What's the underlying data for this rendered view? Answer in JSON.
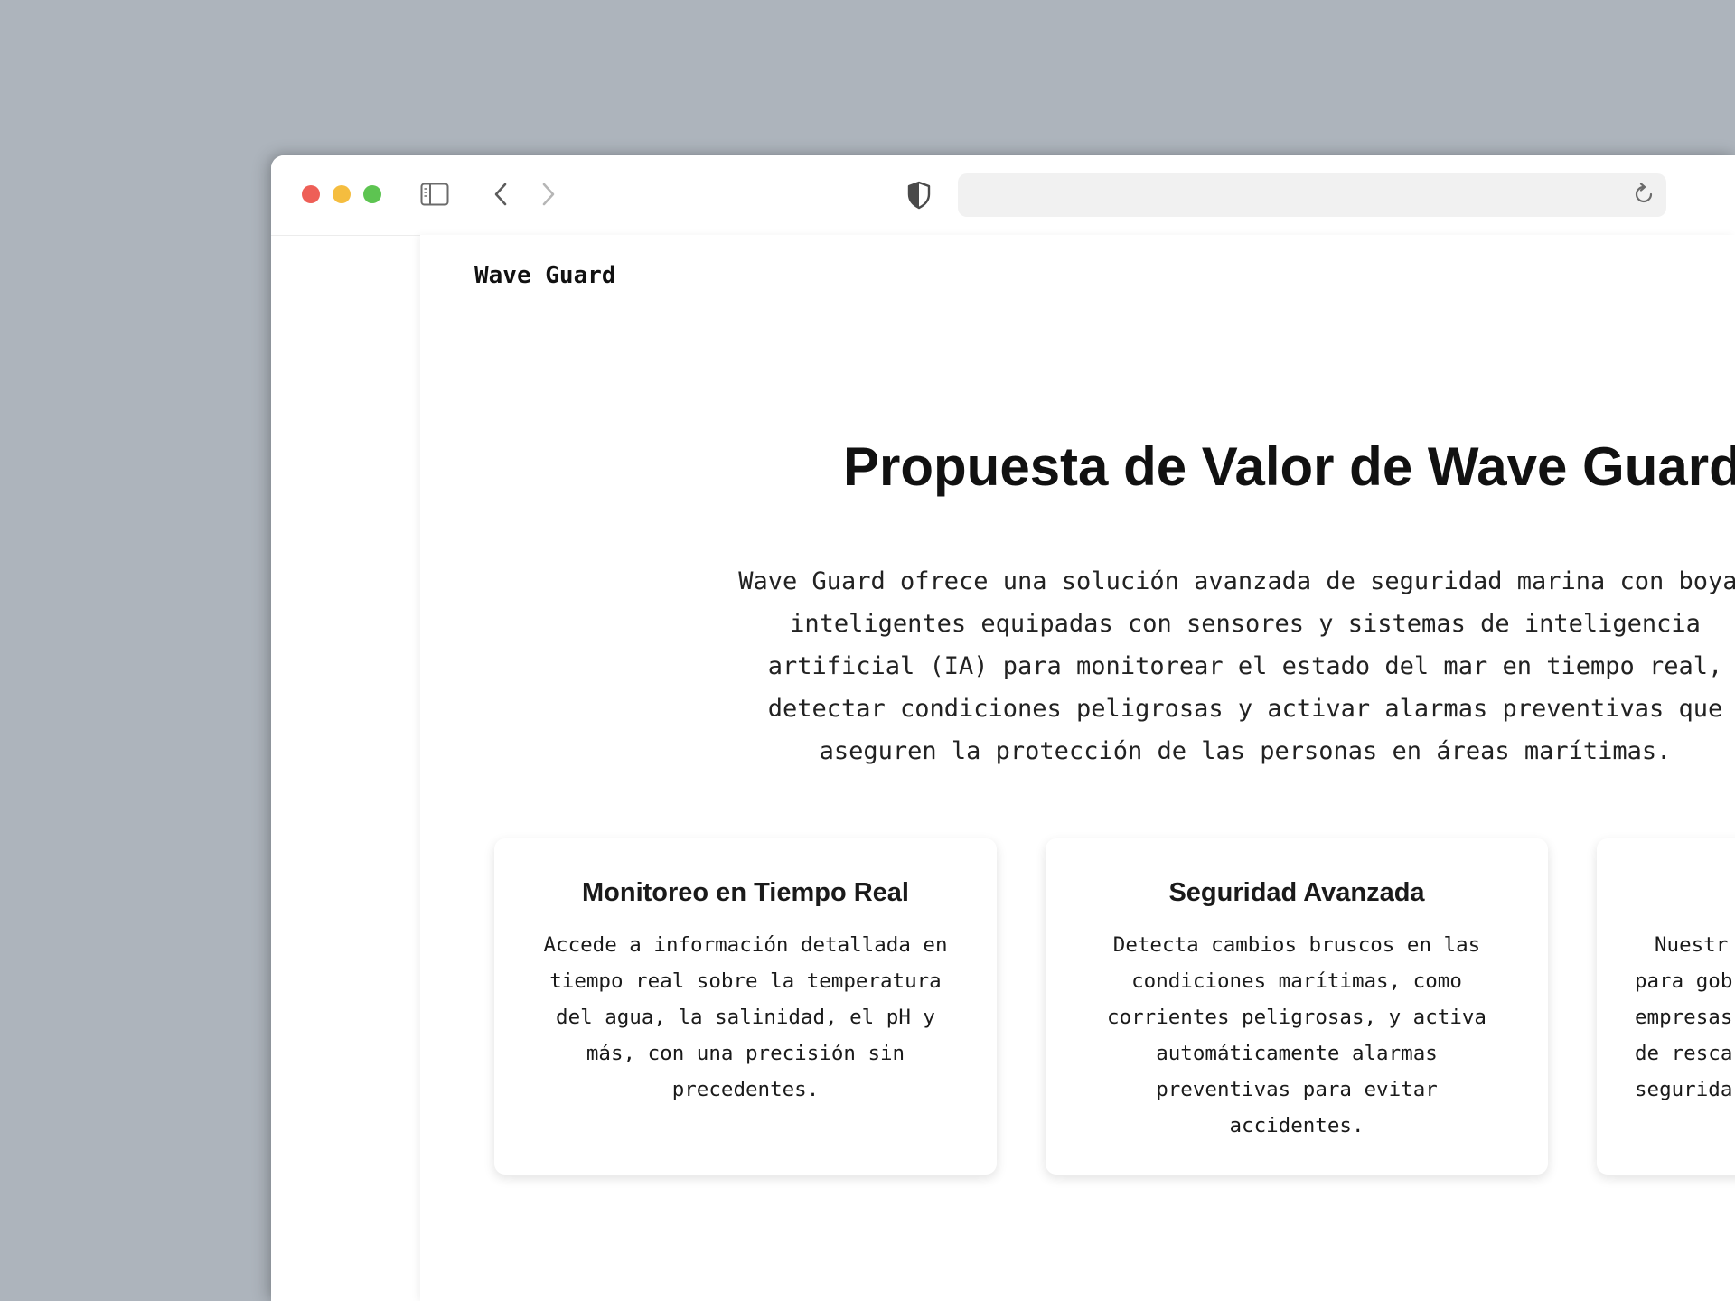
{
  "site": {
    "brand": "Wave Guard"
  },
  "browser": {
    "url": "",
    "icons": [
      "sidebar-icon",
      "chevron-left-icon",
      "chevron-right-icon",
      "shield-icon",
      "reload-icon"
    ]
  },
  "hero": {
    "title": "Propuesta de Valor de Wave Guard",
    "description": "Wave Guard ofrece una solución avanzada de seguridad marina con boyas inteligentes equipadas con sensores y sistemas de inteligencia artificial (IA) para monitorear el estado del mar en tiempo real, detectar condiciones peligrosas y activar alarmas preventivas que aseguren la protección de las personas en áreas marítimas."
  },
  "features": [
    {
      "title": "Monitoreo en Tiempo Real",
      "text": "Accede a información detallada en tiempo real sobre la temperatura del agua, la salinidad, el pH y más, con una precisión sin precedentes."
    },
    {
      "title": "Seguridad Avanzada",
      "text": "Detecta cambios bruscos en las condiciones marítimas, como corrientes peligrosas, y activa automáticamente alarmas preventivas para evitar accidentes."
    },
    {
      "title": "",
      "lines": [
        "Nuestr",
        "para gob",
        "empresas",
        "de resca",
        "segurida"
      ]
    }
  ]
}
